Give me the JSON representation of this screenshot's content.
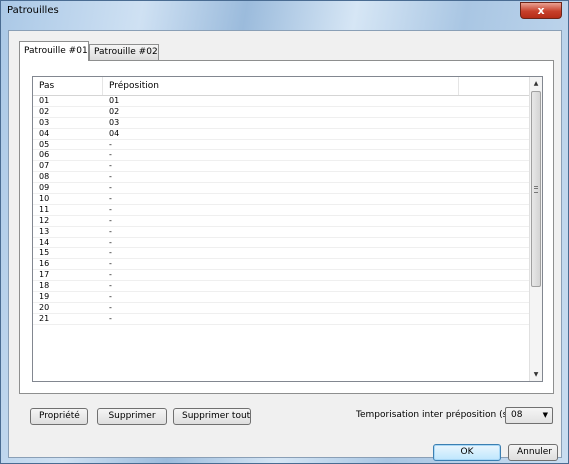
{
  "window": {
    "title": "Patrouilles",
    "close_glyph": "x"
  },
  "tabs": [
    {
      "label": "Patrouille #01",
      "active": true
    },
    {
      "label": "Patrouille #02",
      "active": false
    }
  ],
  "table": {
    "columns": [
      "Pas",
      "Préposition"
    ],
    "rows": [
      [
        "01",
        "01"
      ],
      [
        "02",
        "02"
      ],
      [
        "03",
        "03"
      ],
      [
        "04",
        "04"
      ],
      [
        "05",
        "-"
      ],
      [
        "06",
        "-"
      ],
      [
        "07",
        "-"
      ],
      [
        "08",
        "-"
      ],
      [
        "09",
        "-"
      ],
      [
        "10",
        "-"
      ],
      [
        "11",
        "-"
      ],
      [
        "12",
        "-"
      ],
      [
        "13",
        "-"
      ],
      [
        "14",
        "-"
      ],
      [
        "15",
        "-"
      ],
      [
        "16",
        "-"
      ],
      [
        "17",
        "-"
      ],
      [
        "18",
        "-"
      ],
      [
        "19",
        "-"
      ],
      [
        "20",
        "-"
      ],
      [
        "21",
        "-"
      ]
    ]
  },
  "actions": {
    "propriete_label": "Propriété",
    "supprimer_label": "Supprimer",
    "supprimer_tout_label": "Supprimer tout"
  },
  "temporisation": {
    "label": "Temporisation inter préposition (s) :",
    "value": "08"
  },
  "footer": {
    "ok_label": "OK",
    "cancel_label": "Annuler"
  },
  "icons": {
    "close": "close-icon",
    "scroll_up": "scroll-up-icon",
    "scroll_down": "scroll-down-icon",
    "dropdown": "chevron-down-icon"
  }
}
